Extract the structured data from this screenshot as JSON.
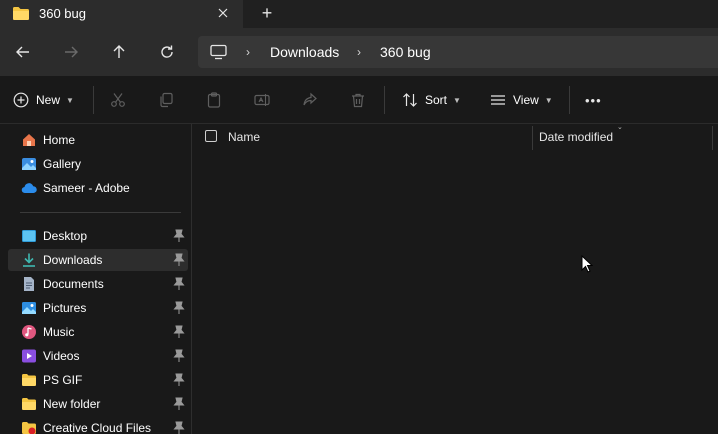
{
  "window": {
    "tab_title": "360 bug",
    "tab_icon": "folder-icon",
    "new_tab_label": "+"
  },
  "address": {
    "crumbs": [
      "Downloads",
      "360 bug"
    ],
    "separator": "›"
  },
  "toolbar": {
    "new_label": "New",
    "sort_label": "Sort",
    "view_label": "View",
    "more_label": "•••"
  },
  "sidebar": {
    "quick": [
      {
        "label": "Home",
        "icon": "home-icon"
      },
      {
        "label": "Gallery",
        "icon": "gallery-icon"
      },
      {
        "label": "Sameer - Adobe",
        "icon": "cloud-icon"
      }
    ],
    "pinned": [
      {
        "label": "Desktop",
        "icon": "desktop-icon"
      },
      {
        "label": "Downloads",
        "icon": "download-icon",
        "selected": true
      },
      {
        "label": "Documents",
        "icon": "document-icon"
      },
      {
        "label": "Pictures",
        "icon": "pictures-icon"
      },
      {
        "label": "Music",
        "icon": "music-icon"
      },
      {
        "label": "Videos",
        "icon": "videos-icon"
      },
      {
        "label": "PS GIF",
        "icon": "folder-icon"
      },
      {
        "label": "New folder",
        "icon": "folder-icon"
      },
      {
        "label": "Creative Cloud Files",
        "icon": "creative-cloud-icon"
      }
    ]
  },
  "content": {
    "columns": {
      "name": "Name",
      "date_modified": "Date modified"
    }
  },
  "colors": {
    "background": "#191919",
    "chrome": "#2c2c2c",
    "folder_yellow": "#f4c542",
    "accent_blue": "#4cc2ff"
  }
}
